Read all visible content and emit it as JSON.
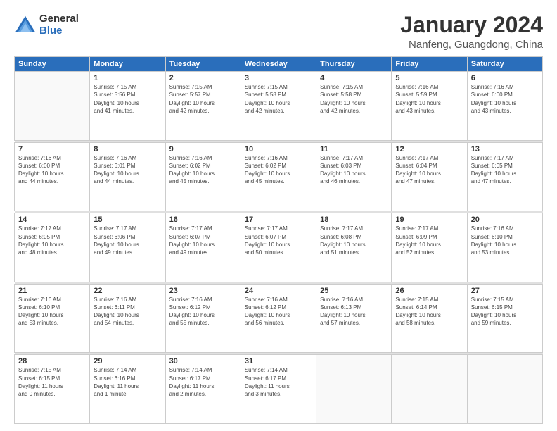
{
  "logo": {
    "line1": "General",
    "line2": "Blue"
  },
  "calendar": {
    "title": "January 2024",
    "subtitle": "Nanfeng, Guangdong, China",
    "days_of_week": [
      "Sunday",
      "Monday",
      "Tuesday",
      "Wednesday",
      "Thursday",
      "Friday",
      "Saturday"
    ],
    "weeks": [
      [
        {
          "day": "",
          "info": ""
        },
        {
          "day": "1",
          "info": "Sunrise: 7:15 AM\nSunset: 5:56 PM\nDaylight: 10 hours\nand 41 minutes."
        },
        {
          "day": "2",
          "info": "Sunrise: 7:15 AM\nSunset: 5:57 PM\nDaylight: 10 hours\nand 42 minutes."
        },
        {
          "day": "3",
          "info": "Sunrise: 7:15 AM\nSunset: 5:58 PM\nDaylight: 10 hours\nand 42 minutes."
        },
        {
          "day": "4",
          "info": "Sunrise: 7:15 AM\nSunset: 5:58 PM\nDaylight: 10 hours\nand 42 minutes."
        },
        {
          "day": "5",
          "info": "Sunrise: 7:16 AM\nSunset: 5:59 PM\nDaylight: 10 hours\nand 43 minutes."
        },
        {
          "day": "6",
          "info": "Sunrise: 7:16 AM\nSunset: 6:00 PM\nDaylight: 10 hours\nand 43 minutes."
        }
      ],
      [
        {
          "day": "7",
          "info": "Sunrise: 7:16 AM\nSunset: 6:00 PM\nDaylight: 10 hours\nand 44 minutes."
        },
        {
          "day": "8",
          "info": "Sunrise: 7:16 AM\nSunset: 6:01 PM\nDaylight: 10 hours\nand 44 minutes."
        },
        {
          "day": "9",
          "info": "Sunrise: 7:16 AM\nSunset: 6:02 PM\nDaylight: 10 hours\nand 45 minutes."
        },
        {
          "day": "10",
          "info": "Sunrise: 7:16 AM\nSunset: 6:02 PM\nDaylight: 10 hours\nand 45 minutes."
        },
        {
          "day": "11",
          "info": "Sunrise: 7:17 AM\nSunset: 6:03 PM\nDaylight: 10 hours\nand 46 minutes."
        },
        {
          "day": "12",
          "info": "Sunrise: 7:17 AM\nSunset: 6:04 PM\nDaylight: 10 hours\nand 47 minutes."
        },
        {
          "day": "13",
          "info": "Sunrise: 7:17 AM\nSunset: 6:05 PM\nDaylight: 10 hours\nand 47 minutes."
        }
      ],
      [
        {
          "day": "14",
          "info": "Sunrise: 7:17 AM\nSunset: 6:05 PM\nDaylight: 10 hours\nand 48 minutes."
        },
        {
          "day": "15",
          "info": "Sunrise: 7:17 AM\nSunset: 6:06 PM\nDaylight: 10 hours\nand 49 minutes."
        },
        {
          "day": "16",
          "info": "Sunrise: 7:17 AM\nSunset: 6:07 PM\nDaylight: 10 hours\nand 49 minutes."
        },
        {
          "day": "17",
          "info": "Sunrise: 7:17 AM\nSunset: 6:07 PM\nDaylight: 10 hours\nand 50 minutes."
        },
        {
          "day": "18",
          "info": "Sunrise: 7:17 AM\nSunset: 6:08 PM\nDaylight: 10 hours\nand 51 minutes."
        },
        {
          "day": "19",
          "info": "Sunrise: 7:17 AM\nSunset: 6:09 PM\nDaylight: 10 hours\nand 52 minutes."
        },
        {
          "day": "20",
          "info": "Sunrise: 7:16 AM\nSunset: 6:10 PM\nDaylight: 10 hours\nand 53 minutes."
        }
      ],
      [
        {
          "day": "21",
          "info": "Sunrise: 7:16 AM\nSunset: 6:10 PM\nDaylight: 10 hours\nand 53 minutes."
        },
        {
          "day": "22",
          "info": "Sunrise: 7:16 AM\nSunset: 6:11 PM\nDaylight: 10 hours\nand 54 minutes."
        },
        {
          "day": "23",
          "info": "Sunrise: 7:16 AM\nSunset: 6:12 PM\nDaylight: 10 hours\nand 55 minutes."
        },
        {
          "day": "24",
          "info": "Sunrise: 7:16 AM\nSunset: 6:12 PM\nDaylight: 10 hours\nand 56 minutes."
        },
        {
          "day": "25",
          "info": "Sunrise: 7:16 AM\nSunset: 6:13 PM\nDaylight: 10 hours\nand 57 minutes."
        },
        {
          "day": "26",
          "info": "Sunrise: 7:15 AM\nSunset: 6:14 PM\nDaylight: 10 hours\nand 58 minutes."
        },
        {
          "day": "27",
          "info": "Sunrise: 7:15 AM\nSunset: 6:15 PM\nDaylight: 10 hours\nand 59 minutes."
        }
      ],
      [
        {
          "day": "28",
          "info": "Sunrise: 7:15 AM\nSunset: 6:15 PM\nDaylight: 11 hours\nand 0 minutes."
        },
        {
          "day": "29",
          "info": "Sunrise: 7:14 AM\nSunset: 6:16 PM\nDaylight: 11 hours\nand 1 minute."
        },
        {
          "day": "30",
          "info": "Sunrise: 7:14 AM\nSunset: 6:17 PM\nDaylight: 11 hours\nand 2 minutes."
        },
        {
          "day": "31",
          "info": "Sunrise: 7:14 AM\nSunset: 6:17 PM\nDaylight: 11 hours\nand 3 minutes."
        },
        {
          "day": "",
          "info": ""
        },
        {
          "day": "",
          "info": ""
        },
        {
          "day": "",
          "info": ""
        }
      ]
    ]
  }
}
